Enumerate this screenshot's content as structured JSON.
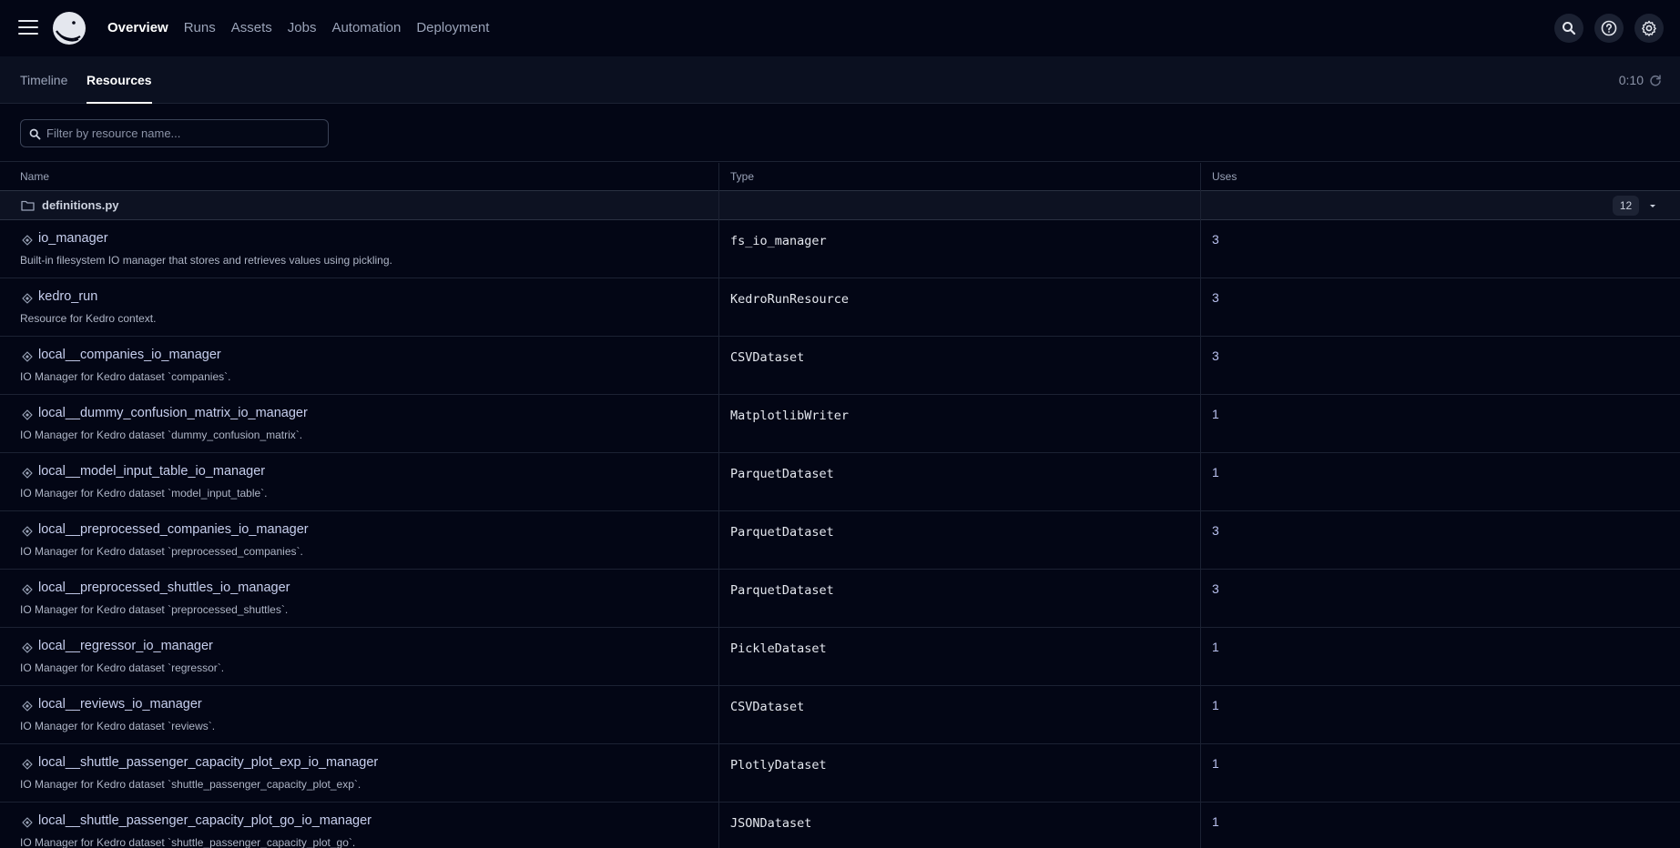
{
  "nav": {
    "items": [
      {
        "label": "Overview",
        "active": true
      },
      {
        "label": "Runs",
        "active": false
      },
      {
        "label": "Assets",
        "active": false
      },
      {
        "label": "Jobs",
        "active": false
      },
      {
        "label": "Automation",
        "active": false
      },
      {
        "label": "Deployment",
        "active": false
      }
    ]
  },
  "subtabs": [
    {
      "label": "Timeline",
      "active": false
    },
    {
      "label": "Resources",
      "active": true
    }
  ],
  "refresh": {
    "countdown": "0:10"
  },
  "filter": {
    "placeholder": "Filter by resource name..."
  },
  "table": {
    "headers": {
      "name": "Name",
      "type": "Type",
      "uses": "Uses"
    },
    "group": {
      "name": "definitions.py",
      "count": "12"
    },
    "rows": [
      {
        "name": "io_manager",
        "description": "Built-in filesystem IO manager that stores and retrieves values using pickling.",
        "type": "fs_io_manager",
        "uses": "3"
      },
      {
        "name": "kedro_run",
        "description": "Resource for Kedro context.",
        "type": "KedroRunResource",
        "uses": "3"
      },
      {
        "name": "local__companies_io_manager",
        "description": "IO Manager for Kedro dataset `companies`.",
        "type": "CSVDataset",
        "uses": "3"
      },
      {
        "name": "local__dummy_confusion_matrix_io_manager",
        "description": "IO Manager for Kedro dataset `dummy_confusion_matrix`.",
        "type": "MatplotlibWriter",
        "uses": "1"
      },
      {
        "name": "local__model_input_table_io_manager",
        "description": "IO Manager for Kedro dataset `model_input_table`.",
        "type": "ParquetDataset",
        "uses": "1"
      },
      {
        "name": "local__preprocessed_companies_io_manager",
        "description": "IO Manager for Kedro dataset `preprocessed_companies`.",
        "type": "ParquetDataset",
        "uses": "3"
      },
      {
        "name": "local__preprocessed_shuttles_io_manager",
        "description": "IO Manager for Kedro dataset `preprocessed_shuttles`.",
        "type": "ParquetDataset",
        "uses": "3"
      },
      {
        "name": "local__regressor_io_manager",
        "description": "IO Manager for Kedro dataset `regressor`.",
        "type": "PickleDataset",
        "uses": "1"
      },
      {
        "name": "local__reviews_io_manager",
        "description": "IO Manager for Kedro dataset `reviews`.",
        "type": "CSVDataset",
        "uses": "1"
      },
      {
        "name": "local__shuttle_passenger_capacity_plot_exp_io_manager",
        "description": "IO Manager for Kedro dataset `shuttle_passenger_capacity_plot_exp`.",
        "type": "PlotlyDataset",
        "uses": "1"
      },
      {
        "name": "local__shuttle_passenger_capacity_plot_go_io_manager",
        "description": "IO Manager for Kedro dataset `shuttle_passenger_capacity_plot_go`.",
        "type": "JSONDataset",
        "uses": "1"
      }
    ]
  },
  "icons": {
    "menu": "hamburger-icon",
    "logo": "dagster-logo-icon",
    "search": "search-icon",
    "help": "help-icon",
    "settings": "gear-icon",
    "refresh": "refresh-icon",
    "folder": "folder-icon",
    "resource": "resource-icon",
    "chevron": "chevron-down-icon"
  }
}
